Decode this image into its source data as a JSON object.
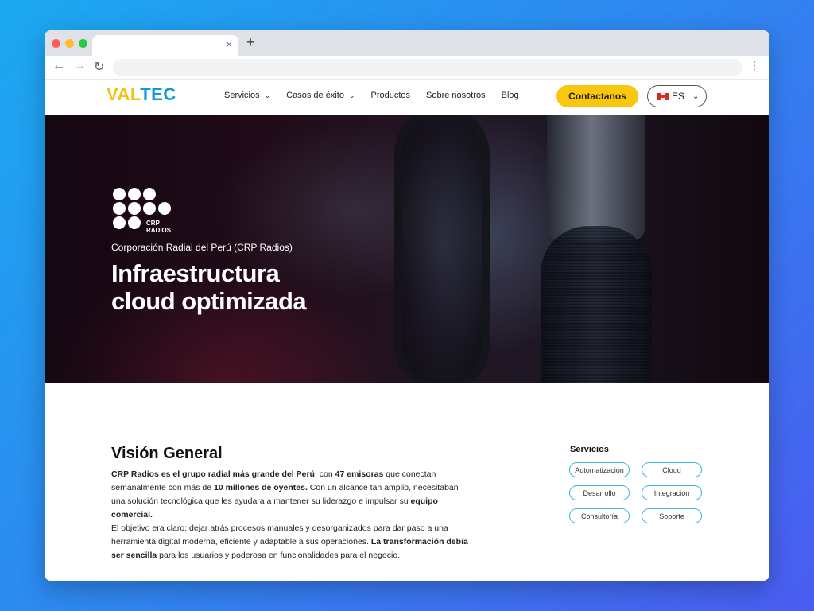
{
  "browser": {
    "tab_close": "×",
    "new_tab": "+",
    "back": "←",
    "forward": "→",
    "reload": "↻",
    "menu": "⋮",
    "address": ""
  },
  "header": {
    "logo_prefix": "VAL",
    "logo_suffix": "TEC",
    "nav": [
      {
        "label": "Servicios",
        "chevron": "⌄"
      },
      {
        "label": "Casos de éxito",
        "chevron": "⌄"
      },
      {
        "label": "Productos"
      },
      {
        "label": "Sobre nosotros"
      },
      {
        "label": "Blog"
      }
    ],
    "cta_label": "Contactanos",
    "lang_label": "ES",
    "lang_chevron": "⌄",
    "accent_color": "#f9c80e",
    "brand_color": "#0e9bd3"
  },
  "hero": {
    "client_logo_text_1": "CRP",
    "client_logo_text_2": "RADIOS",
    "subtitle": "Corporación Radial del Perú (CRP Radios)",
    "title_line_1": "Infraestructura",
    "title_line_2": "cloud optimizada"
  },
  "overview": {
    "title": "Visión General",
    "p1_a": "CRP Radios es el grupo radial más grande del Perú",
    "p1_b": ", con ",
    "p1_c": "47 emisoras",
    "p1_d": " que conectan semanalmente con más de ",
    "p1_e": "10 millones de oyentes.",
    "p1_f": " Con un alcance tan amplio, necesitaban una solución tecnológica que les ayudara a mantener su liderazgo e impulsar su ",
    "p1_g": "equipo comercial.",
    "p2_a": "El objetivo era claro: dejar atrás procesos manuales y desorganizados para dar paso a una herramienta digital moderna, eficiente y adaptable a sus operaciones. ",
    "p2_b": "La transformación debía ser sencilla",
    "p2_c": " para los usuarios y poderosa en funcionalidades para el negocio."
  },
  "services": {
    "title": "Servicios",
    "chips": [
      "Automatización",
      "Cloud",
      "Desarrollo",
      "Integración",
      "Consultoría",
      "Soporte"
    ]
  }
}
